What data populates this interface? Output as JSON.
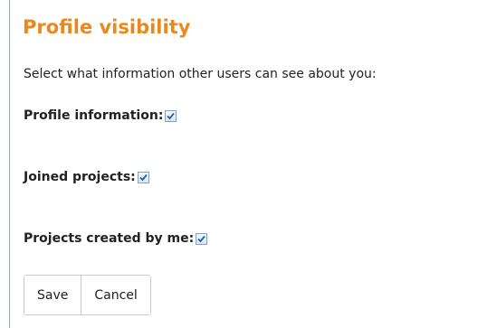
{
  "section": {
    "title": "Profile visibility",
    "intro": "Select what information other users can see about you:"
  },
  "options": [
    {
      "label": "Profile information:",
      "checked": true
    },
    {
      "label": "Joined projects:",
      "checked": true
    },
    {
      "label": "Projects created by me:",
      "checked": true
    }
  ],
  "buttons": {
    "save": "Save",
    "cancel": "Cancel"
  },
  "colors": {
    "title": "#e8891c",
    "checkmark": "#2a5ea8"
  }
}
